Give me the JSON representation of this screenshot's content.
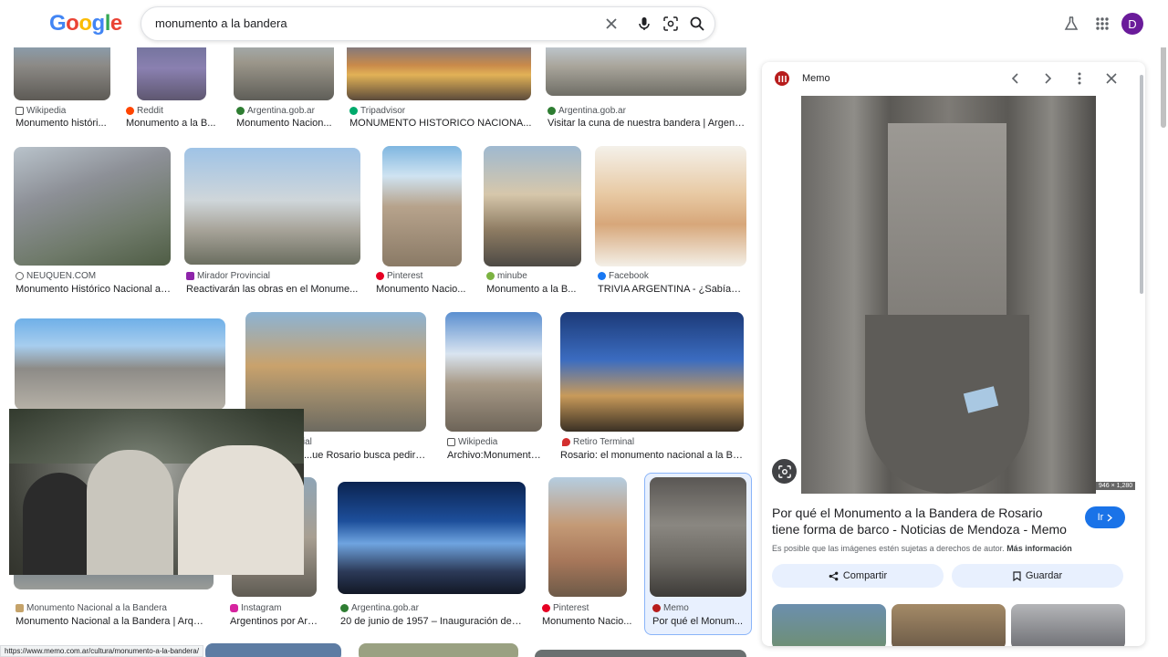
{
  "search": {
    "query": "monumento a la bandera"
  },
  "header": {
    "logo": "Google",
    "avatar_letter": "D"
  },
  "rows": [
    [
      {
        "source": "Wikipedia",
        "title": "Monumento históri..."
      },
      {
        "source": "Reddit",
        "title": "Monumento a la B..."
      },
      {
        "source": "Argentina.gob.ar",
        "title": "Monumento Nacion..."
      },
      {
        "source": "Tripadvisor",
        "title": "MONUMENTO HISTORICO NACIONA..."
      },
      {
        "source": "Argentina.gob.ar",
        "title": "Visitar la cuna de nuestra bandera | Argenti..."
      }
    ],
    [
      {
        "source": "NEUQUEN.COM",
        "title": "Monumento Histórico Nacional a ..."
      },
      {
        "source": "Mirador Provincial",
        "title": "Reactivarán las obras en el Monume..."
      },
      {
        "source": "Pinterest",
        "title": "Monumento Nacio..."
      },
      {
        "source": "minube",
        "title": "Monumento a la B..."
      },
      {
        "source": "Facebook",
        "title": "TRIVIA ARGENTINA - ¿Sabías ..."
      }
    ],
    [
      {
        "source": "...ncial",
        "title": "...ue Rosario busca pedirle ..."
      },
      {
        "source": "Wikipedia",
        "title": "Archivo:Monumento..."
      },
      {
        "source": "Retiro Terminal",
        "title": "Rosario: el monumento nacional a la Ba..."
      }
    ],
    [
      {
        "source": "Monumento Nacional a la Bandera",
        "title": "Monumento Nacional a la Bandera | Arquit..."
      },
      {
        "source": "Instagram",
        "title": "Argentinos por Arg..."
      },
      {
        "source": "Argentina.gob.ar",
        "title": "20 de junio de 1957 – Inauguración del ..."
      },
      {
        "source": "Pinterest",
        "title": "Monumento Nacio..."
      },
      {
        "source": "Memo",
        "title": "Por qué el Monum..."
      }
    ]
  ],
  "panel": {
    "source": "Memo",
    "dimensions": "946 × 1,280",
    "title": "Por qué el Monumento a la Bandera de Rosario tiene forma de barco - Noticias de Mendoza - Memo",
    "go_label": "Ir",
    "rights_text": "Es posible que las imágenes estén sujetas a derechos de autor.",
    "rights_link": "Más información",
    "share_label": "Compartir",
    "save_label": "Guardar"
  },
  "status_url": "https://www.memo.com.ar/cultura/monumento-a-la-bandera/",
  "colors": {
    "accent": "#1a73e8",
    "pinterest": "#e60023",
    "memo": "#b71c1c",
    "avatar": "#6a1b9a"
  }
}
